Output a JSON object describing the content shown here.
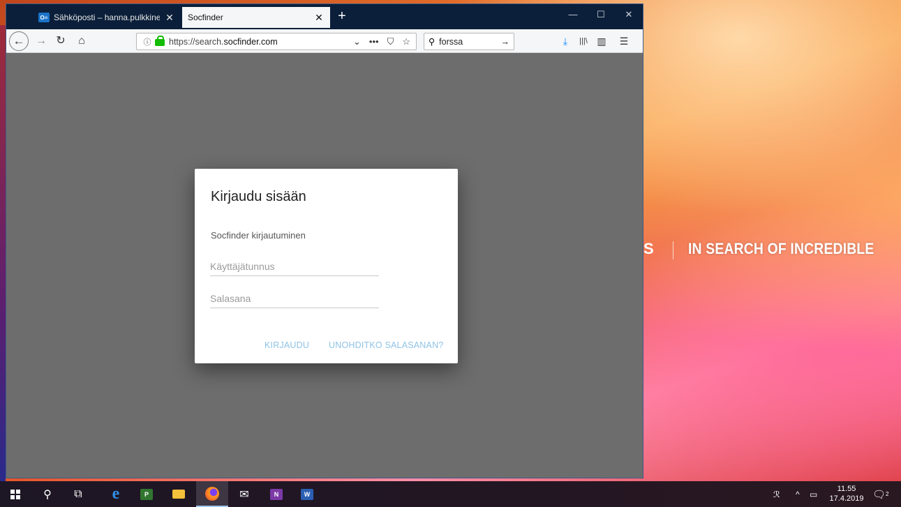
{
  "browser": {
    "tabs": [
      {
        "label": "Sähköposti – hanna.pulkkinen@",
        "favicon": "O≡",
        "close": "✕"
      },
      {
        "label": "Socfinder",
        "close": "✕"
      }
    ],
    "new_tab": "+",
    "window_controls": {
      "minimize": "—",
      "maximize": "☐",
      "close": "✕"
    },
    "nav": {
      "back": "←",
      "forward": "→",
      "reload": "↻",
      "home": "⌂"
    },
    "url_prefix": "https://search.",
    "url_domain": "socfinder.com",
    "url_actions": {
      "dropdown": "⌄",
      "more": "•••",
      "pocket": "⛉",
      "bookmark": "☆"
    },
    "search_value": "forssa",
    "search_go": "→",
    "toolbar_icons": {
      "downloads": "⤓",
      "library": "|||\\",
      "sidebar": "▥",
      "menu": "☰"
    }
  },
  "dialog": {
    "title": "Kirjaudu sisään",
    "subtitle": "Socfinder kirjautuminen",
    "username_placeholder": "Käyttäjätunnus",
    "password_placeholder": "Salasana",
    "login_label": "KIRJAUDU",
    "forgot_label": "UNOHDITKO SALASANAN?"
  },
  "wallpaper": {
    "brand_letter": "S",
    "slogan": "IN SEARCH OF INCREDIBLE"
  },
  "taskbar": {
    "clock_time": "11.55",
    "clock_date": "17.4.2019",
    "notifications": "2"
  }
}
